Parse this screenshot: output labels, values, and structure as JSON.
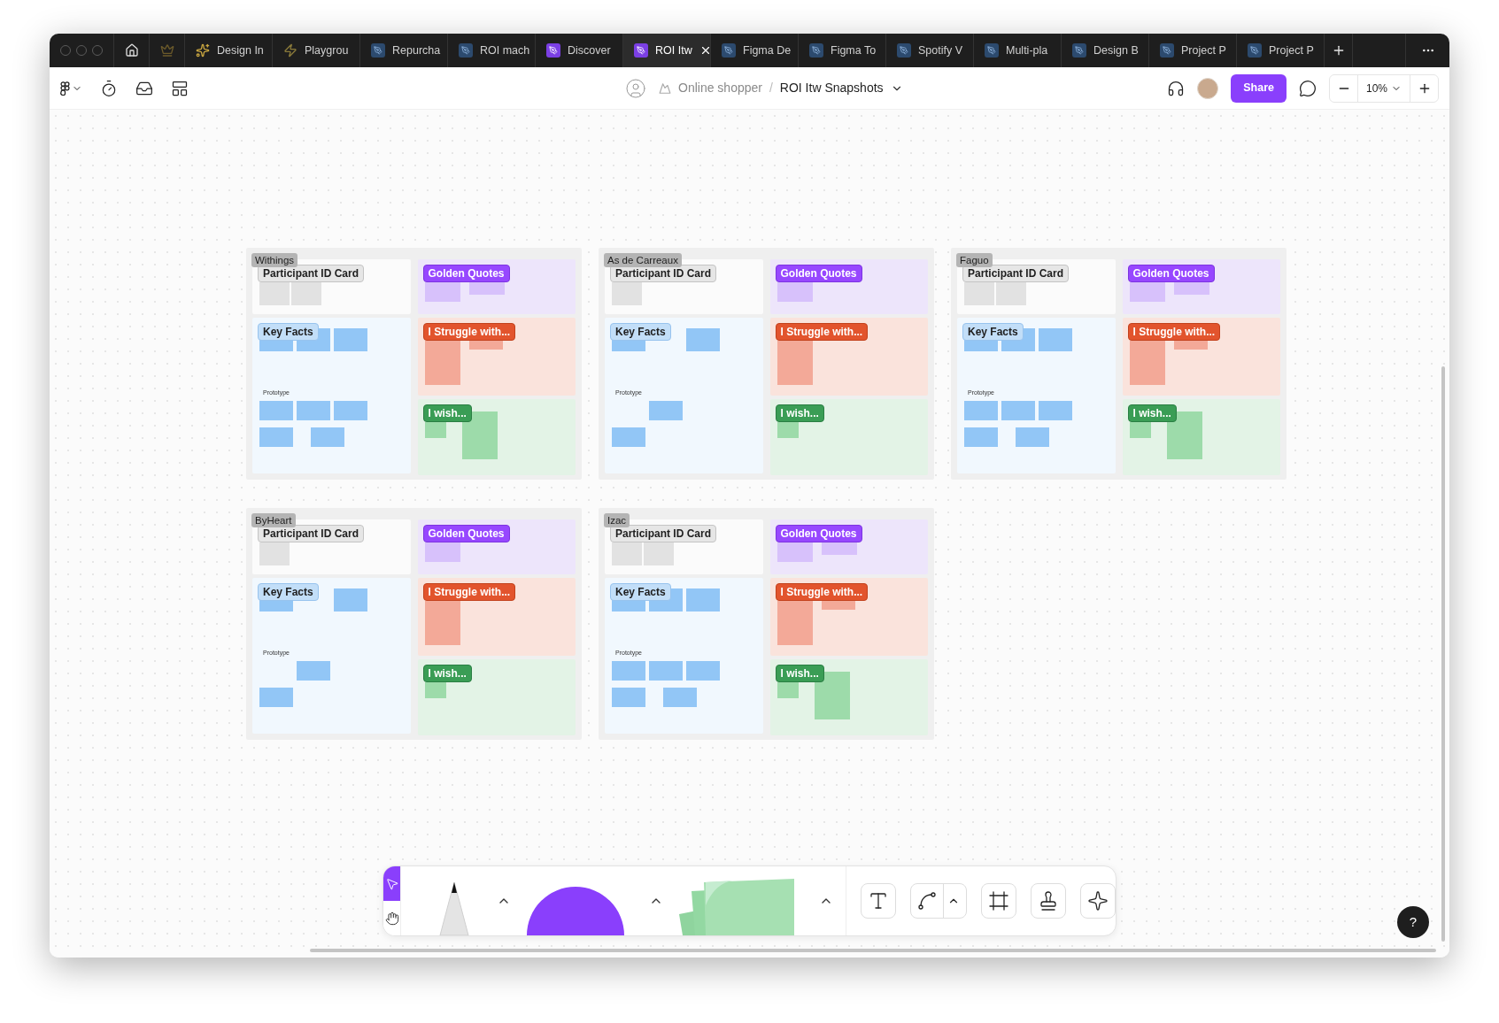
{
  "tabs": [
    {
      "label": "Design In",
      "kind": "sparkle",
      "selected": false
    },
    {
      "label": "Playgrou",
      "kind": "bolt",
      "selected": false
    },
    {
      "label": "Repurcha",
      "kind": "design",
      "selected": false
    },
    {
      "label": "ROI mach",
      "kind": "design",
      "selected": false
    },
    {
      "label": "Discover",
      "kind": "board",
      "selected": false
    },
    {
      "label": "ROI Itw",
      "kind": "board",
      "selected": true
    },
    {
      "label": "Figma De",
      "kind": "design",
      "selected": false
    },
    {
      "label": "Figma To",
      "kind": "design",
      "selected": false
    },
    {
      "label": "Spotify V",
      "kind": "design",
      "selected": false
    },
    {
      "label": "Multi-pla",
      "kind": "design",
      "selected": false
    },
    {
      "label": "Design B",
      "kind": "design",
      "selected": false
    },
    {
      "label": "Project P",
      "kind": "design",
      "selected": false
    },
    {
      "label": "Project P",
      "kind": "design",
      "selected": false
    }
  ],
  "toolbar": {
    "team": "Online shopper",
    "separator": "/",
    "file": "ROI Itw Snapshots",
    "share": "Share",
    "zoom": "10%"
  },
  "boards": [
    {
      "name": "Withings",
      "sections": [
        {
          "kind": "id_card",
          "title": "Participant ID Card"
        },
        {
          "kind": "key_facts",
          "title": "Key Facts",
          "subheading": "Prototype"
        },
        {
          "kind": "quotes",
          "title": "Golden Quotes"
        },
        {
          "kind": "struggle",
          "title": "I Struggle with..."
        },
        {
          "kind": "wish",
          "title": "I wish..."
        }
      ]
    },
    {
      "name": "As de Carreaux",
      "sections": [
        {
          "kind": "id_card",
          "title": "Participant ID Card"
        },
        {
          "kind": "key_facts",
          "title": "Key Facts",
          "subheading": "Prototype"
        },
        {
          "kind": "quotes",
          "title": "Golden Quotes"
        },
        {
          "kind": "struggle",
          "title": "I Struggle with..."
        },
        {
          "kind": "wish",
          "title": "I wish..."
        }
      ]
    },
    {
      "name": "Faguo",
      "sections": [
        {
          "kind": "id_card",
          "title": "Participant ID Card"
        },
        {
          "kind": "key_facts",
          "title": "Key Facts",
          "subheading": "Prototype"
        },
        {
          "kind": "quotes",
          "title": "Golden Quotes"
        },
        {
          "kind": "struggle",
          "title": "I Struggle with..."
        },
        {
          "kind": "wish",
          "title": "I wish..."
        }
      ]
    },
    {
      "name": "ByHeart",
      "sections": [
        {
          "kind": "id_card",
          "title": "Participant ID Card"
        },
        {
          "kind": "key_facts",
          "title": "Key Facts",
          "subheading": "Prototype"
        },
        {
          "kind": "quotes",
          "title": "Golden Quotes"
        },
        {
          "kind": "struggle",
          "title": "I Struggle with..."
        },
        {
          "kind": "wish",
          "title": "I wish..."
        }
      ]
    },
    {
      "name": "Izac",
      "sections": [
        {
          "kind": "id_card",
          "title": "Participant ID Card"
        },
        {
          "kind": "key_facts",
          "title": "Key Facts",
          "subheading": "Prototype"
        },
        {
          "kind": "quotes",
          "title": "Golden Quotes"
        },
        {
          "kind": "struggle",
          "title": "I Struggle with..."
        },
        {
          "kind": "wish",
          "title": "I wish..."
        }
      ]
    }
  ],
  "tools": [
    {
      "kind": "select",
      "selected": true
    },
    {
      "kind": "hand",
      "selected": false
    }
  ],
  "help": "?"
}
